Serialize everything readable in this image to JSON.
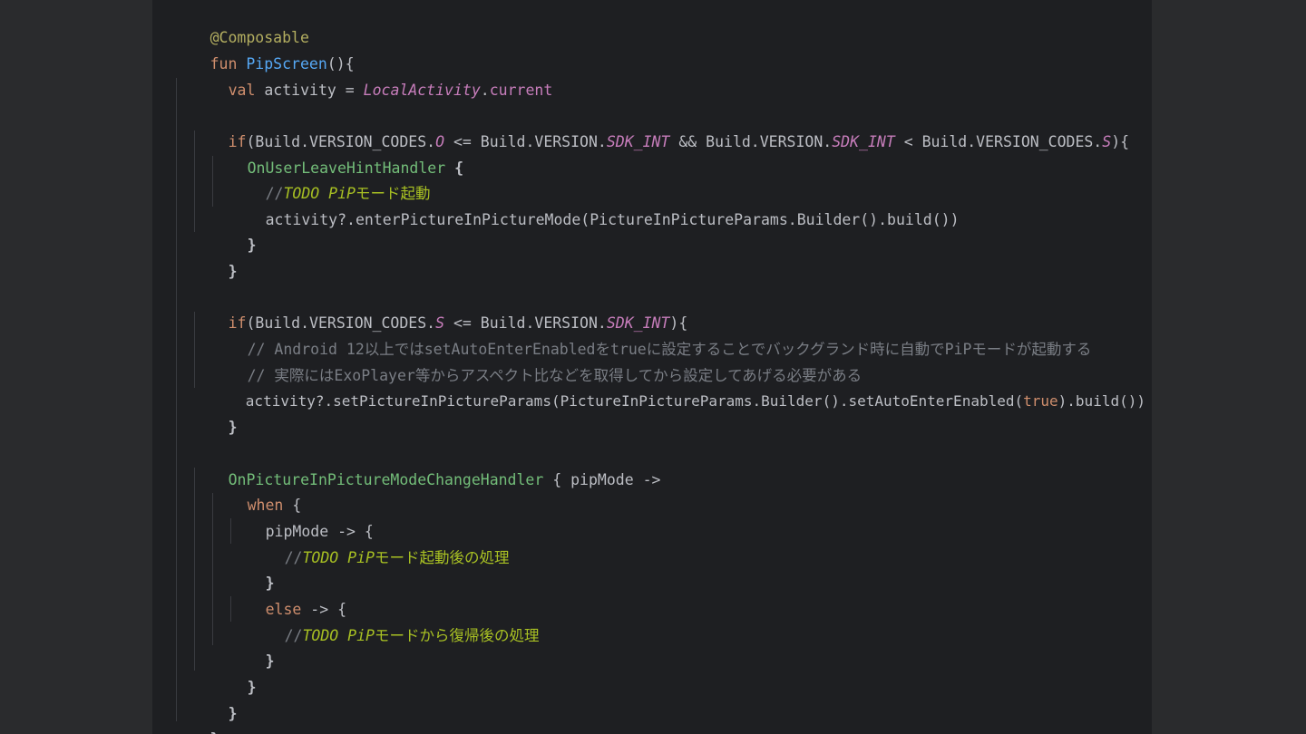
{
  "lines": {
    "l1": {
      "annotation": "@Composable"
    },
    "l2": {
      "kw": "fun ",
      "name": "PipScreen",
      "rest": "(){"
    },
    "l3": {
      "kw": "val ",
      "p1": "activity = ",
      "local": "LocalActivity",
      "dot": ".",
      "prop": "current"
    },
    "l5": {
      "kw": "if",
      "p1": "(Build.VERSION_CODES.",
      "c1": "O",
      "p2": " <= Build.VERSION.",
      "c2": "SDK_INT",
      "p3": " && Build.VERSION.",
      "c3": "SDK_INT",
      "p4": " < Build.VERSION_CODES.",
      "c4": "S",
      "p5": "){"
    },
    "l6": {
      "handler": "OnUserLeaveHintHandler",
      "rest": " {"
    },
    "l7": {
      "slashes": "//",
      "todo": "TODO PiP",
      "text": "モード起動"
    },
    "l8": {
      "text": "activity?.enterPictureInPictureMode(PictureInPictureParams.Builder().build())"
    },
    "l9": {
      "text": "}"
    },
    "l10": {
      "text": "}"
    },
    "l12": {
      "kw": "if",
      "p1": "(Build.VERSION_CODES.",
      "c1": "S",
      "p2": " <= Build.VERSION.",
      "c2": "SDK_INT",
      "p3": "){"
    },
    "l13": {
      "text": "// Android 12以上ではsetAutoEnterEnabledをtrueに設定することでバックグランド時に自動でPiPモードが起動する"
    },
    "l14": {
      "text": "// 実際にはExoPlayer等からアスペクト比などを取得してから設定してあげる必要がある"
    },
    "l15": {
      "p1": "activity?.setPictureInPictureParams(PictureInPictureParams.Builder().setAutoEnterEnabled(",
      "bool": "true",
      "p2": ").build())"
    },
    "l16": {
      "text": "}"
    },
    "l18": {
      "handler": "OnPictureInPictureModeChangeHandler",
      "rest": " { pipMode ->"
    },
    "l19": {
      "kw": "when",
      "rest": " {"
    },
    "l20": {
      "text": "pipMode -> {"
    },
    "l21": {
      "slashes": "//",
      "todo": "TODO PiP",
      "text": "モード起動後の処理"
    },
    "l22": {
      "text": "}"
    },
    "l23": {
      "kw": "else",
      "rest": " -> {"
    },
    "l24": {
      "slashes": "//",
      "todo": "TODO PiP",
      "text": "モードから復帰後の処理"
    },
    "l25": {
      "text": "}"
    },
    "l26": {
      "text": "}"
    },
    "l27": {
      "text": "}"
    },
    "l28": {
      "text": "}"
    }
  },
  "colors": {
    "background": "#1e1f22",
    "keyword": "#cf8e6d",
    "function": "#56a8f5",
    "composable": "#57aaf7",
    "handler": "#73bd79",
    "property": "#c77dbb",
    "comment": "#7a7e85",
    "todo": "#a8c023",
    "annotation": "#b3ae60"
  }
}
